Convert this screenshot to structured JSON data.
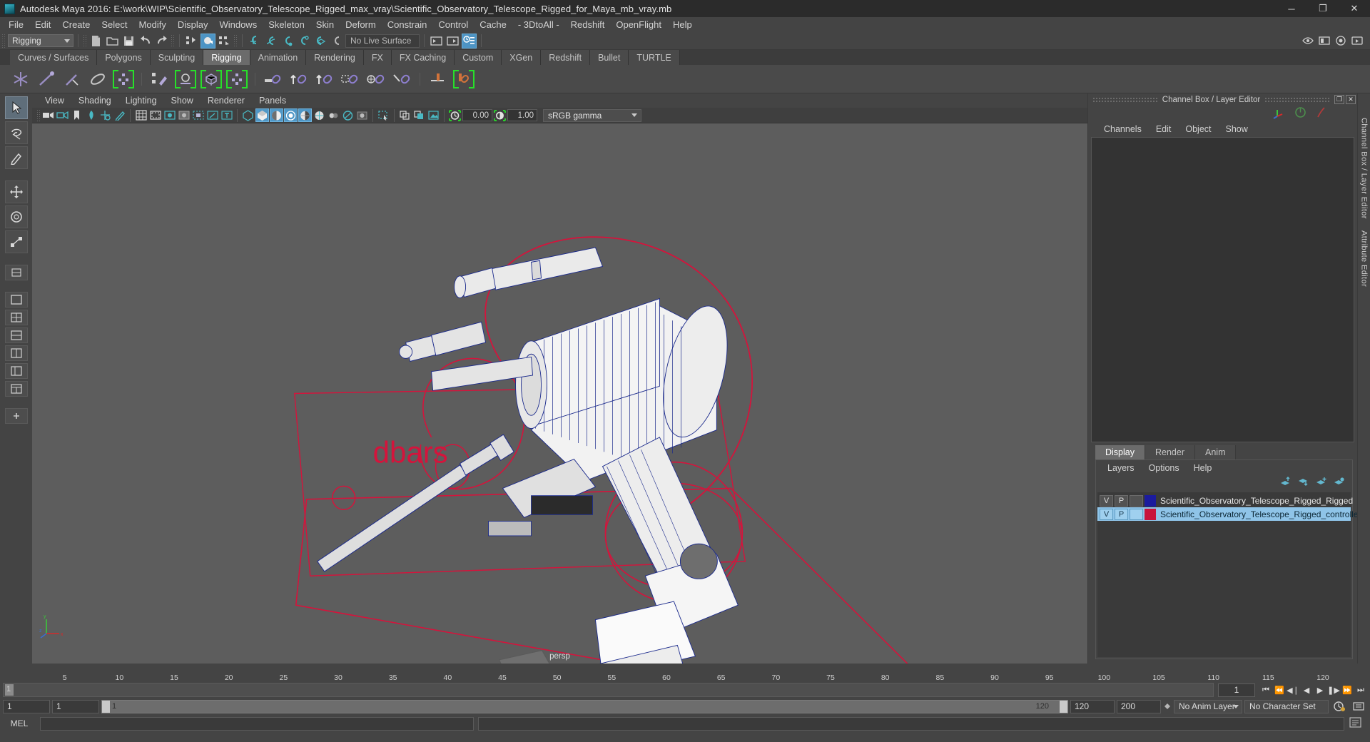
{
  "titlebar": {
    "icon": "maya-app-icon",
    "text": "Autodesk Maya 2016: E:\\work\\WIP\\Scientific_Observatory_Telescope_Rigged_max_vray\\Scientific_Observatory_Telescope_Rigged_for_Maya_mb_vray.mb",
    "minimize": "─",
    "maximize": "❐",
    "close": "✕"
  },
  "menubar": {
    "items": [
      "File",
      "Edit",
      "Create",
      "Select",
      "Modify",
      "Display",
      "Windows",
      "Skeleton",
      "Skin",
      "Deform",
      "Constrain",
      "Control",
      "Cache",
      "- 3DtoAll -",
      "Redshift",
      "OpenFlight",
      "Help"
    ]
  },
  "toolbar": {
    "menuset": "Rigging",
    "live_surface": "No Live Surface"
  },
  "shelf": {
    "tabs": [
      "Curves / Surfaces",
      "Polygons",
      "Sculpting",
      "Rigging",
      "Animation",
      "Rendering",
      "FX",
      "FX Caching",
      "Custom",
      "XGen",
      "Redshift",
      "Bullet",
      "TURTLE"
    ],
    "active_tab": "Rigging"
  },
  "viewport": {
    "menus": [
      "View",
      "Shading",
      "Lighting",
      "Show",
      "Renderer",
      "Panels"
    ],
    "exposure": "0.00",
    "gamma": "1.00",
    "color_profile": "sRGB gamma",
    "camera_label": "persp",
    "annotation_text": "dbars",
    "axis": {
      "x": "x",
      "y": "y",
      "z": "z"
    },
    "background_color": "#5d5d5d",
    "wire_color": "#1b2a8c",
    "controller_color": "#d4143c",
    "mesh_color": "#f2f2f2"
  },
  "right_panel": {
    "title": "Channel Box / Layer Editor",
    "restore_glyph": "❐",
    "close_glyph": "✕",
    "channel_menus": [
      "Channels",
      "Edit",
      "Object",
      "Show"
    ],
    "layer_tabs": [
      "Display",
      "Render",
      "Anim"
    ],
    "active_layer_tab": "Display",
    "layer_menus": [
      "Layers",
      "Options",
      "Help"
    ],
    "layers": [
      {
        "v": "V",
        "p": "P",
        "third": "",
        "color": "#1b1b9e",
        "name": "Scientific_Observatory_Telescope_Rigged_Rigged",
        "selected": false
      },
      {
        "v": "V",
        "p": "P",
        "third": "",
        "color": "#c8143c",
        "name": "Scientific_Observatory_Telescope_Rigged_controllers",
        "selected": true
      }
    ],
    "side_tabs": [
      "Channel Box / Layer Editor",
      "Attribute Editor"
    ]
  },
  "timeline": {
    "ticks": [
      "5",
      "10",
      "15",
      "20",
      "25",
      "30",
      "35",
      "40",
      "45",
      "50",
      "55",
      "60",
      "65",
      "70",
      "75",
      "80",
      "85",
      "90",
      "95",
      "100",
      "105",
      "110",
      "115",
      "120"
    ],
    "start_label": "1",
    "current_frame": "1",
    "range_start": "1",
    "range_start2": "1",
    "range_inner_start": "1",
    "range_inner_end": "120",
    "range_end": "120",
    "playback_end": "200",
    "anim_layer": "No Anim Layer",
    "character_set": "No Character Set",
    "transport": [
      "⏮",
      "⏪",
      "◀❘",
      "◀",
      "▶",
      "❚▶",
      "⏩",
      "⏭"
    ]
  },
  "commandline": {
    "label": "MEL",
    "value": ""
  }
}
